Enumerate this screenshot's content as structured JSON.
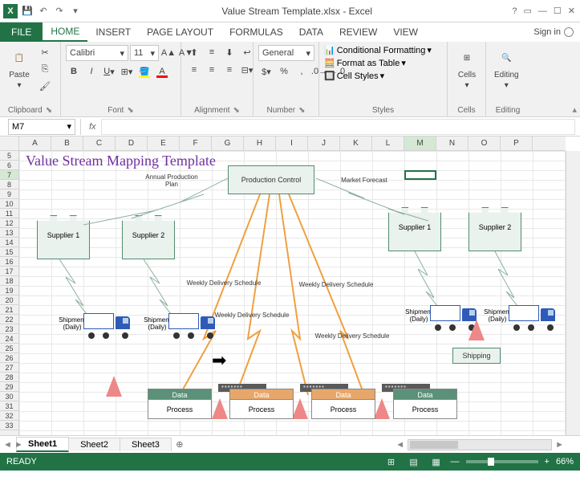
{
  "title": "Value Stream Template.xlsx - Excel",
  "signin": "Sign in",
  "tabs": [
    "FILE",
    "HOME",
    "INSERT",
    "PAGE LAYOUT",
    "FORMULAS",
    "DATA",
    "REVIEW",
    "VIEW"
  ],
  "active_tab": "HOME",
  "ribbon": {
    "clipboard": {
      "label": "Clipboard",
      "paste": "Paste"
    },
    "font": {
      "label": "Font",
      "name": "Calibri",
      "size": "11"
    },
    "alignment": {
      "label": "Alignment"
    },
    "number": {
      "label": "Number",
      "format": "General"
    },
    "styles": {
      "label": "Styles",
      "cond": "Conditional Formatting",
      "table": "Format as Table",
      "cell": "Cell Styles"
    },
    "cells": {
      "label": "Cells",
      "btn": "Cells"
    },
    "editing": {
      "label": "Editing",
      "btn": "Editing"
    }
  },
  "namebox": "M7",
  "formula": "",
  "cols": [
    "A",
    "B",
    "C",
    "D",
    "E",
    "F",
    "G",
    "H",
    "I",
    "J",
    "K",
    "L",
    "M",
    "N",
    "O",
    "P"
  ],
  "rows_start": 5,
  "rows_end": 33,
  "active_col": "M",
  "active_row": 7,
  "doc": {
    "title": "Value Stream Mapping Template",
    "prod_ctrl": "Production Control",
    "annual": "Annual Production Plan",
    "forecast": "Market Forecast",
    "suppliers": [
      "Supplier 1",
      "Supplier 2",
      "Supplier 1",
      "Supplier 2"
    ],
    "wds": "Weekly Delivery Schedule",
    "shipment": "Shipment (Daily)",
    "shipping": "Shipping",
    "data": "Data",
    "process": "Process"
  },
  "sheets": [
    "Sheet1",
    "Sheet2",
    "Sheet3"
  ],
  "active_sheet": "Sheet1",
  "status": {
    "ready": "READY",
    "zoom": "66%"
  }
}
